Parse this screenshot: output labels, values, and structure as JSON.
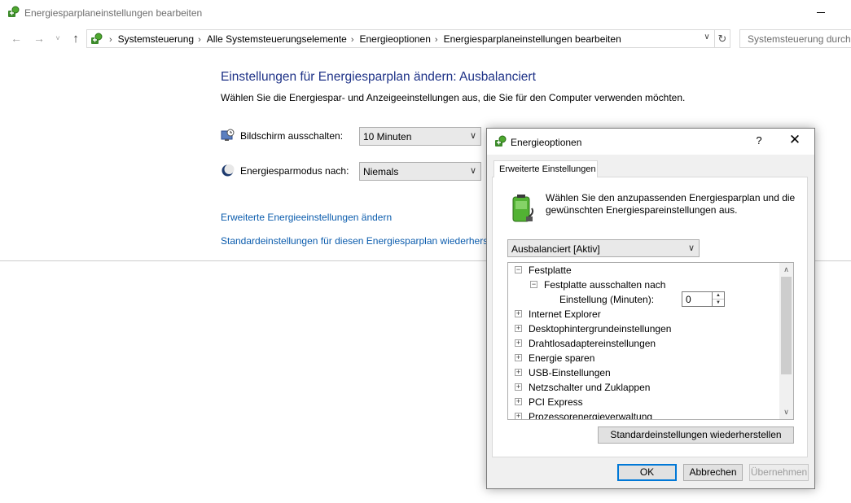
{
  "window": {
    "title": "Energiesparplaneinstellungen bearbeiten"
  },
  "nav": {
    "back_glyph": "←",
    "forward_glyph": "→",
    "recent_glyph": "˅",
    "up_glyph": "↑",
    "breadcrumbs": [
      "Systemsteuerung",
      "Alle Systemsteuerungselemente",
      "Energieoptionen",
      "Energiesparplaneinstellungen bearbeiten"
    ],
    "crumb_separator": "›",
    "dropdown_glyph": "∨",
    "refresh_glyph": "↻",
    "search_placeholder": "Systemsteuerung durchsuchen"
  },
  "main": {
    "title": "Einstellungen für Energiesparplan ändern: Ausbalanciert",
    "subtitle": "Wählen Sie die Energiespar- und Anzeigeeinstellungen aus, die Sie für den Computer verwenden möchten.",
    "display_off": {
      "label": "Bildschirm ausschalten:",
      "value": "10 Minuten"
    },
    "sleep": {
      "label": "Energiesparmodus nach:",
      "value": "Niemals"
    },
    "advanced_link": "Erweiterte Energieeinstellungen ändern",
    "restore_link": "Standardeinstellungen für diesen Energiesparplan wiederherstellen"
  },
  "dialog": {
    "title": "Energieoptionen",
    "help_glyph": "?",
    "close_glyph": "✕",
    "tab_label": "Erweiterte Einstellungen",
    "description": "Wählen Sie den anzupassenden Energiesparplan und die gewünschten Energiespareinstellungen aus.",
    "plan_selected": "Ausbalanciert [Aktiv]",
    "tree": {
      "hdd": "Festplatte",
      "hdd_off": "Festplatte ausschalten nach",
      "setting_label": "Einstellung (Minuten):",
      "setting_value": "0",
      "collapsed_items": [
        "Internet Explorer",
        "Desktophintergrundeinstellungen",
        "Drahtlosadaptereinstellungen",
        "Energie sparen",
        "USB-Einstellungen",
        "Netzschalter und Zuklappen",
        "PCI Express",
        "Prozessorenergieverwaltung"
      ],
      "expanded_glyph": "−",
      "collapsed_glyph": "+"
    },
    "restore_button": "Standardeinstellungen wiederherstellen",
    "ok_button": "OK",
    "cancel_button": "Abbrechen",
    "apply_button": "Übernehmen"
  },
  "colors": {
    "title_blue": "#1e3287",
    "link_blue": "#0b5cad",
    "focus_blue": "#0078d7"
  }
}
